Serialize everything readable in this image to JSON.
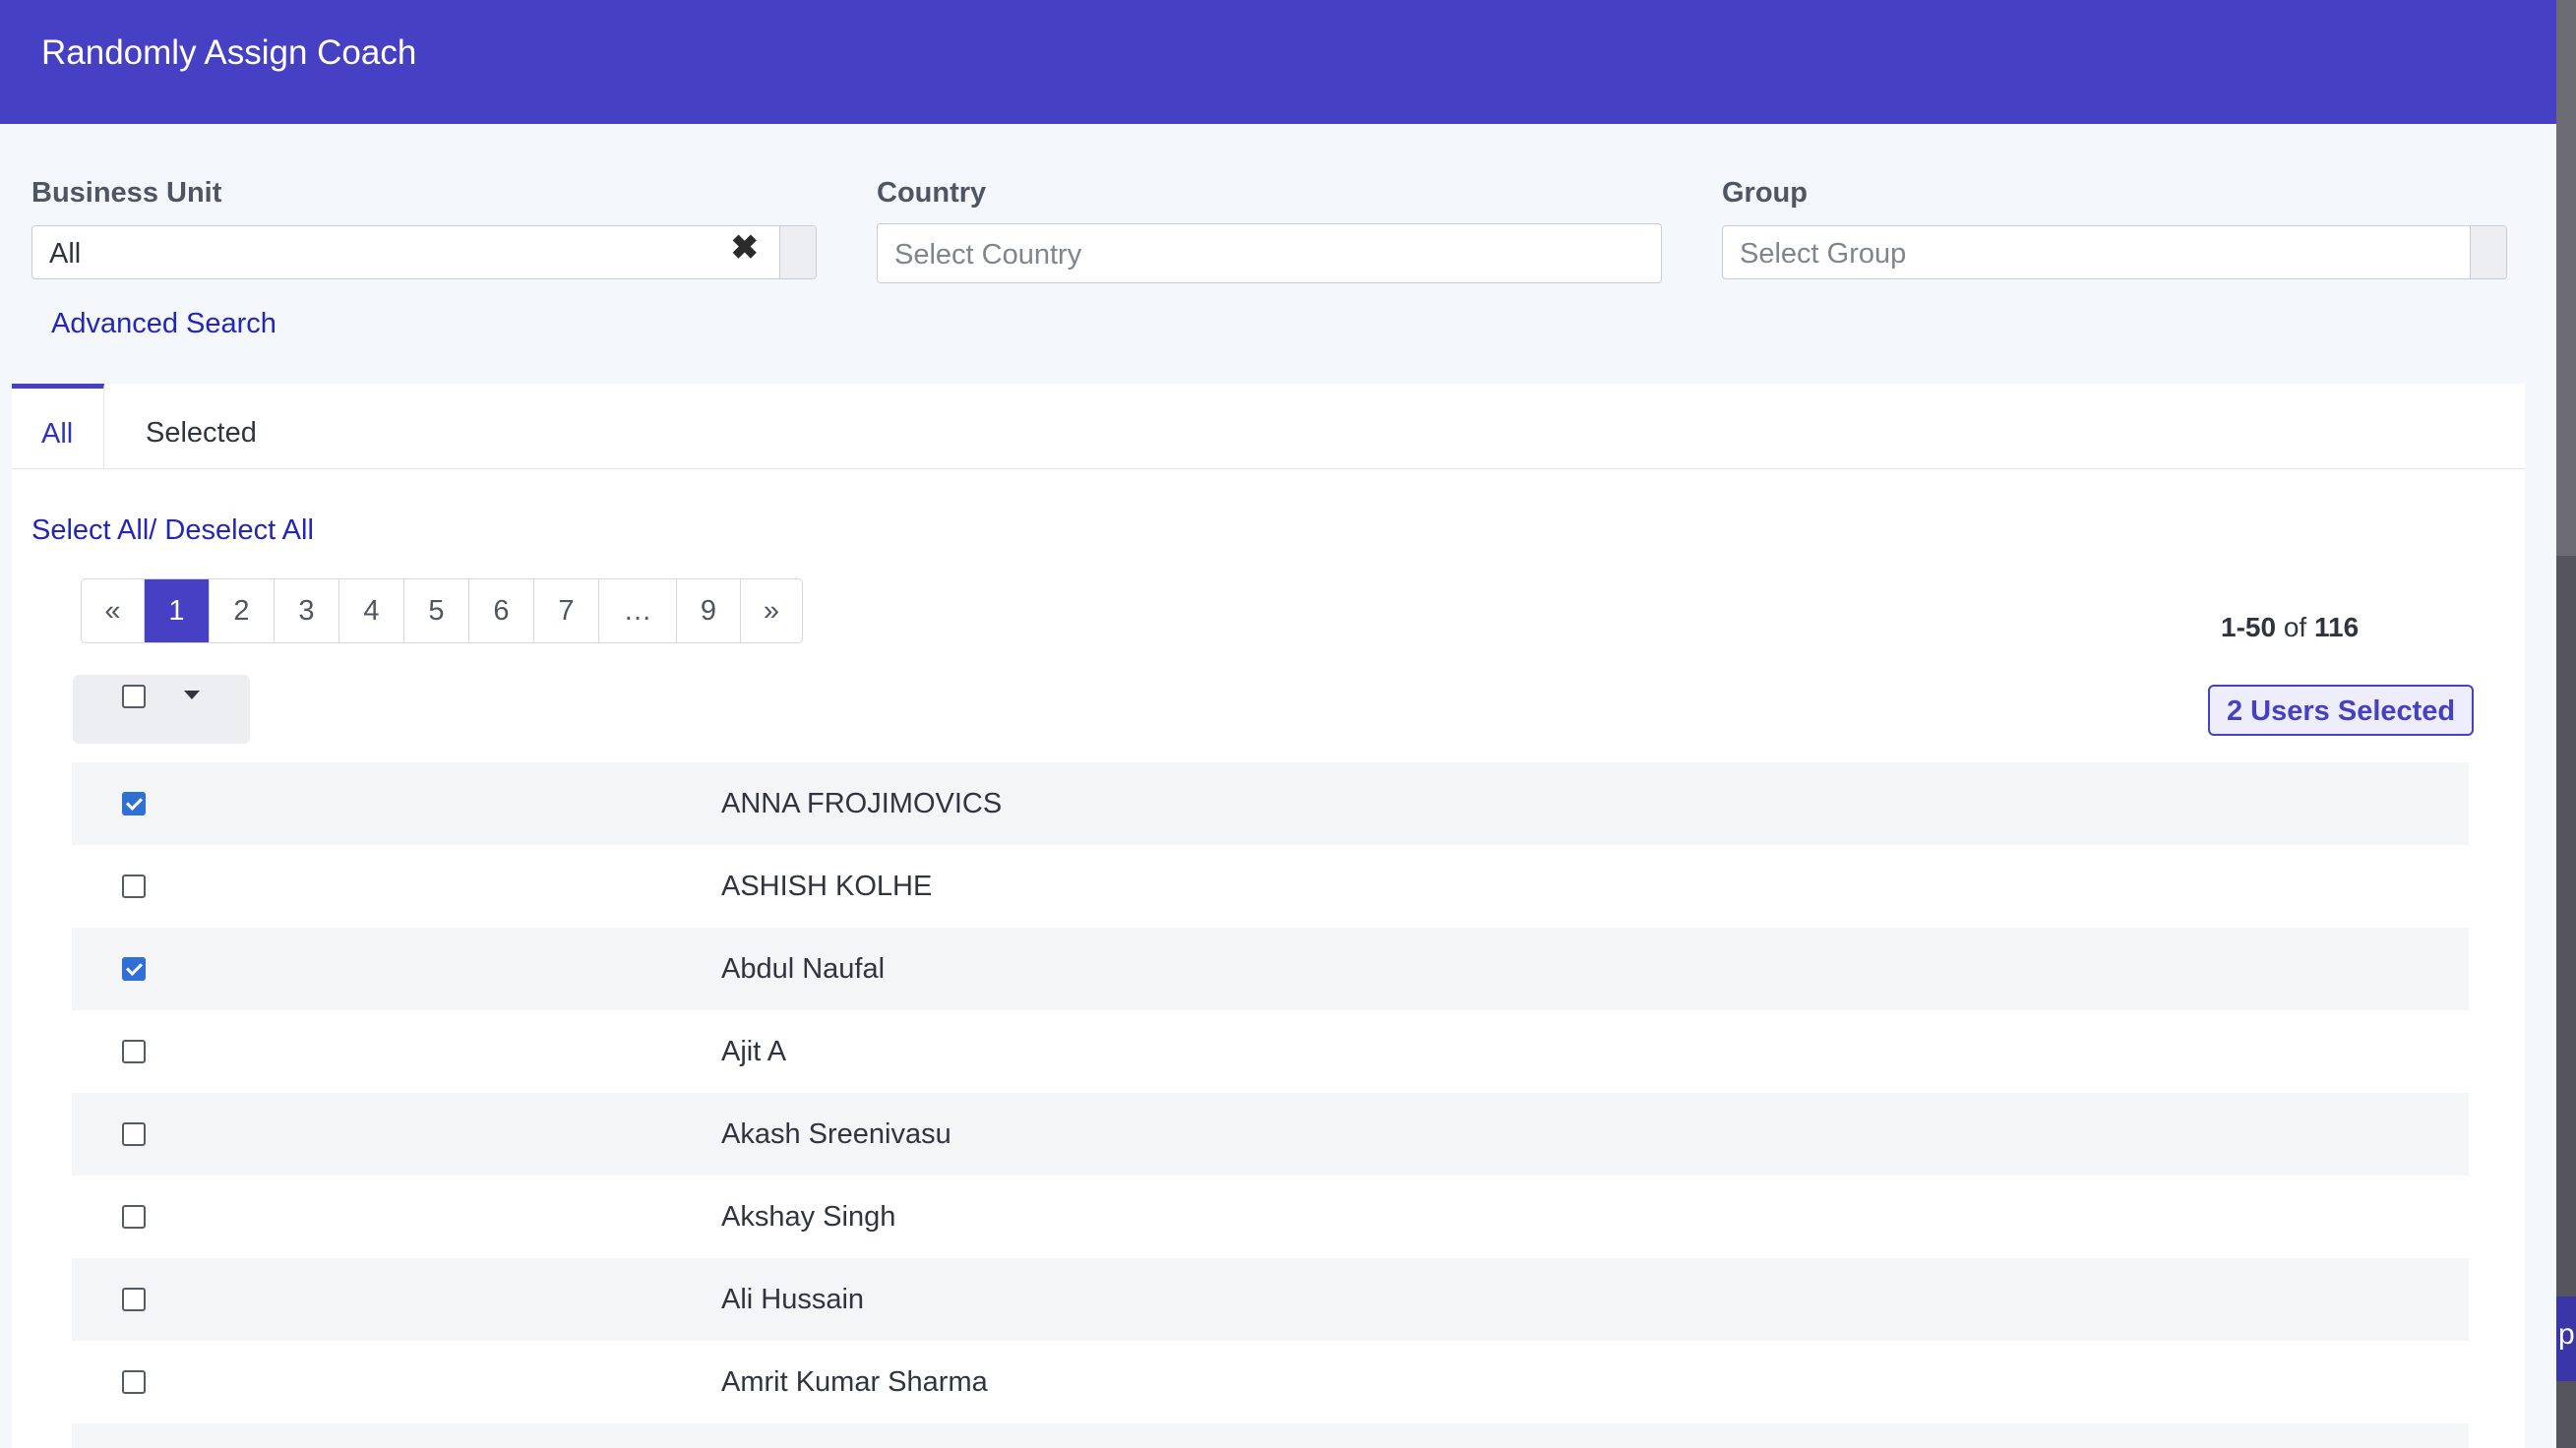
{
  "header": {
    "title": "Randomly Assign Coach"
  },
  "filters": {
    "business_unit": {
      "label": "Business Unit",
      "value": "All",
      "clear_symbol": "✖"
    },
    "country": {
      "label": "Country",
      "placeholder": "Select Country"
    },
    "group": {
      "label": "Group",
      "placeholder": "Select Group"
    },
    "advanced_search": "Advanced Search"
  },
  "tabs": [
    {
      "label": "All",
      "active": true
    },
    {
      "label": "Selected",
      "active": false
    }
  ],
  "select_all_label": "Select All/ Deselect All",
  "pagination": {
    "prev": "«",
    "pages": [
      "1",
      "2",
      "3",
      "4",
      "5",
      "6",
      "7",
      "…",
      "9"
    ],
    "next": "»",
    "active_page": "1"
  },
  "range": {
    "start_end": "1-50",
    "of": "of",
    "total": "116"
  },
  "selected_badge": "2 Users Selected",
  "users": [
    {
      "name": "ANNA FROJIMOVICS",
      "checked": true
    },
    {
      "name": "ASHISH KOLHE",
      "checked": false
    },
    {
      "name": "Abdul Naufal",
      "checked": true
    },
    {
      "name": "Ajit A",
      "checked": false
    },
    {
      "name": "Akash Sreenivasu",
      "checked": false
    },
    {
      "name": "Akshay Singh",
      "checked": false
    },
    {
      "name": "Ali Hussain",
      "checked": false
    },
    {
      "name": "Amrit Kumar Sharma",
      "checked": false
    },
    {
      "name": "",
      "checked": false
    }
  ],
  "colors": {
    "accent": "#4640c4",
    "link": "#2426b7",
    "checkbox_checked": "#2f6fd6"
  },
  "edge_fragment": "p"
}
